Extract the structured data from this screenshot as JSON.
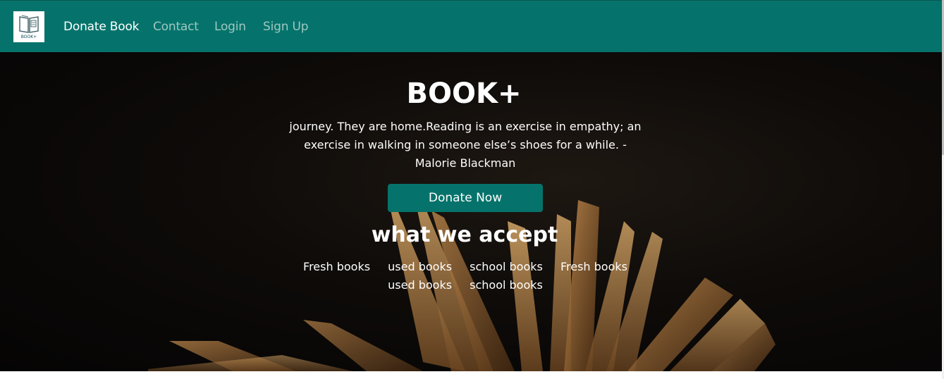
{
  "brand": {
    "logo_text": "BOOK+"
  },
  "nav": {
    "donate_book": "Donate Book",
    "contact": "Contact",
    "login": "Login",
    "sign_up": "Sign Up"
  },
  "hero": {
    "title": "BOOK+",
    "quote": "journey. They are home.Reading is an exercise in empathy; an exercise in walking in someone else’s shoes for a while. -Malorie Blackman",
    "donate_button": "Donate Now"
  },
  "accept": {
    "title": "what we accept",
    "items": [
      "Fresh books",
      "used books",
      "school books",
      "Fresh books",
      "used books",
      "school books"
    ]
  },
  "colors": {
    "primary": "#05736b",
    "text_light": "#ffffff",
    "nav_muted": "#9ec7c2"
  },
  "icons": {
    "logo": "book-logo-icon"
  }
}
